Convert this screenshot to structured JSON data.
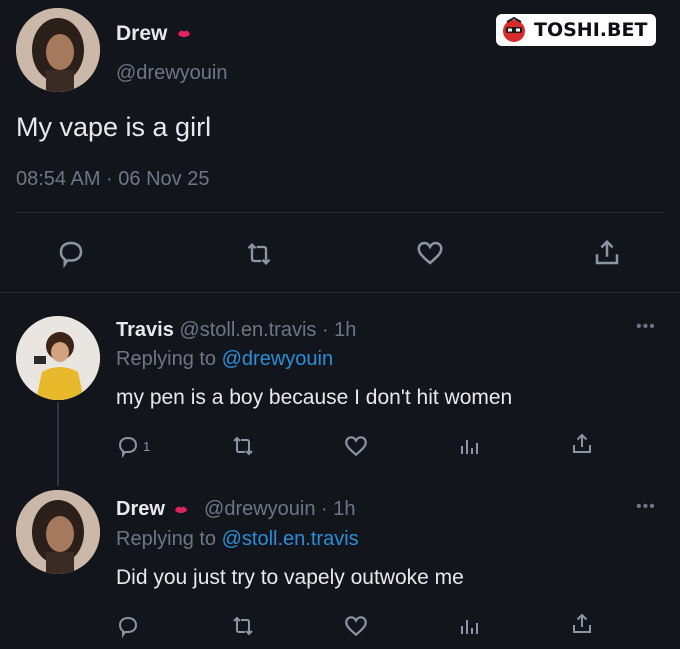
{
  "brand": {
    "logo_text": "TOSHI.BET"
  },
  "main_tweet": {
    "display_name": "Drew",
    "handle": "@drewyouin",
    "text": "My vape is a girl",
    "timestamp": "08:54 AM · 06 Nov 25",
    "badge_icon": "lips-icon"
  },
  "replies": [
    {
      "display_name": "Travis",
      "meta": "@stoll.en.travis · 1h",
      "replying_prefix": "Replying to",
      "replying_to": "@drewyouin",
      "text": "my pen is a boy because I don't hit women",
      "reply_count": "1"
    },
    {
      "display_name": "Drew",
      "meta": "@drewyouin · 1h",
      "replying_prefix": "Replying to",
      "replying_to": "@stoll.en.travis",
      "text": "Did you just try to vapely outwoke me",
      "reply_count": ""
    }
  ],
  "colors": {
    "background": "#12151c",
    "link": "#2a8fd8",
    "icon": "#8b96a3",
    "badge_red": "#e0245e"
  }
}
